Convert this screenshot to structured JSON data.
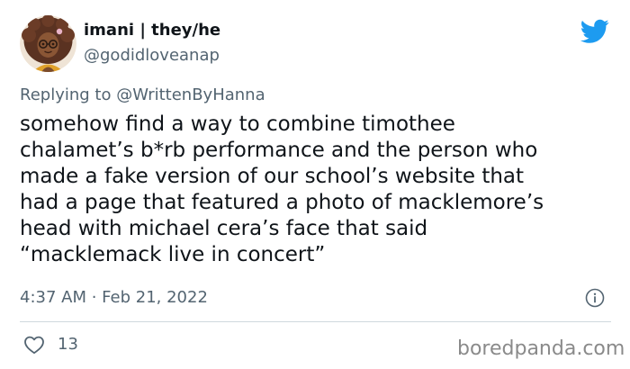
{
  "tweet": {
    "author": {
      "display_name": "imani | they/he",
      "handle": "@godidloveanap",
      "avatar_icon": "cartoon-avatar-icon"
    },
    "brand_icon": "twitter-bird-icon",
    "reply": {
      "prefix": "Replying to",
      "mention": "@WrittenByHanna"
    },
    "text_lines": [
      "somehow find a way to combine timothee",
      "chalamet’s b*rb performance and the person who",
      "made a fake version of our school’s website that",
      "had a page that featured a photo of macklemore’s",
      "head with michael cera’s face that said",
      "“macklemack live in concert”"
    ],
    "timestamp": "4:37 AM · Feb 21, 2022",
    "info_icon": "info-icon",
    "likes": {
      "icon": "heart-icon",
      "count": "13"
    }
  },
  "watermark": "boredpanda.com",
  "colors": {
    "text_primary": "#0f1419",
    "text_secondary": "#536471",
    "twitter_blue": "#1d9bf0",
    "divider": "#cfd9de",
    "watermark": "#8a8a8a"
  }
}
